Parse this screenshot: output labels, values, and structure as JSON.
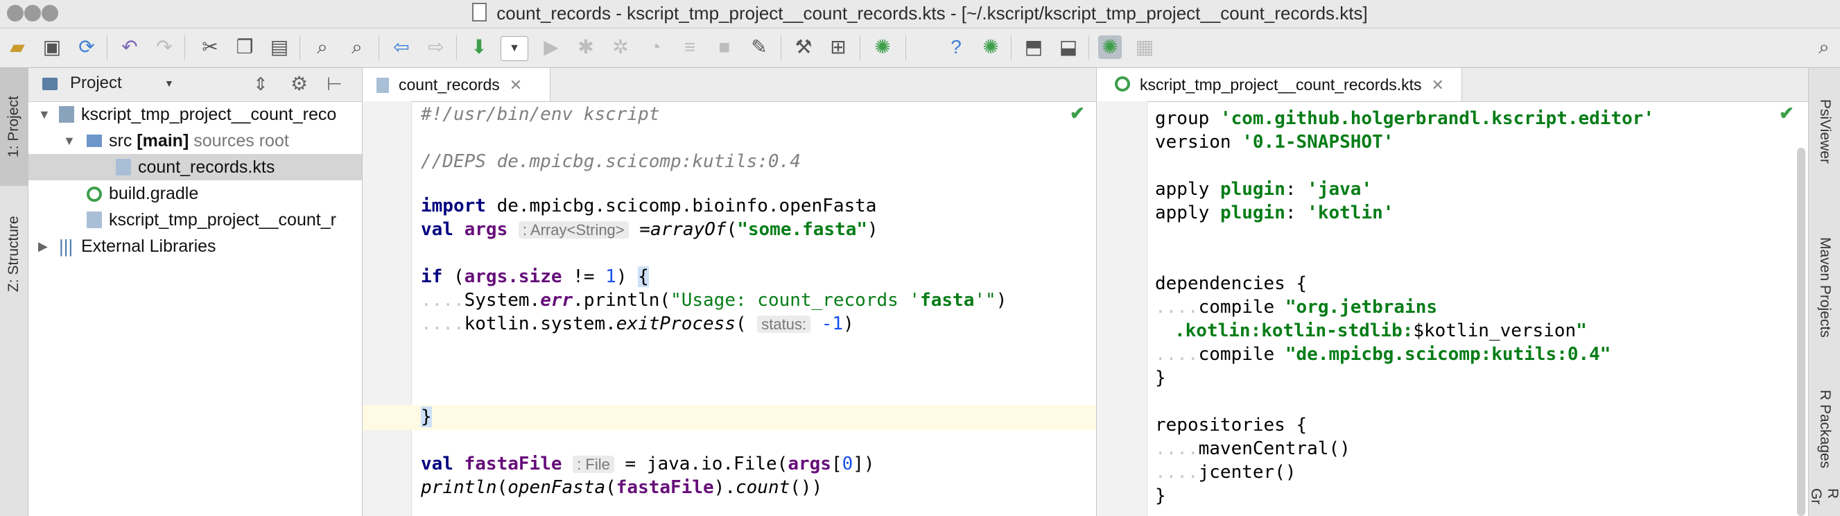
{
  "window": {
    "title": "count_records - kscript_tmp_project__count_records.kts - [~/.kscript/kscript_tmp_project__count_records.kts]"
  },
  "toolbar": {
    "icons": [
      "open-folder-icon",
      "save-icon",
      "sync-icon",
      "undo-icon",
      "redo-icon",
      "cut-icon",
      "copy-icon",
      "paste-icon",
      "find-icon",
      "replace-icon",
      "back-icon",
      "forward-icon",
      "build-icon",
      "run-config-dropdown",
      "run-icon",
      "debug-icon",
      "coverage-icon",
      "profile-icon",
      "attach-icon",
      "stop-icon",
      "edit-icon",
      "settings-icon",
      "project-structure-icon",
      "android-icon",
      "help-icon",
      "android-device-icon",
      "sdk-icon",
      "avd-icon",
      "android-monitor-icon",
      "layout-inspector-icon",
      "search-everywhere-icon"
    ]
  },
  "left_tools": {
    "project_tab": "1: Project",
    "structure_tab": "Z: Structure"
  },
  "project_panel": {
    "header": "Project",
    "tree": [
      {
        "label": "kscript_tmp_project__count_reco",
        "depth": 0,
        "expanded": true
      },
      {
        "label": "src",
        "bold": "[main]",
        "suffix": "sources root",
        "depth": 1,
        "expanded": true
      },
      {
        "label": "count_records.kts",
        "depth": 2,
        "selected": true
      },
      {
        "label": "build.gradle",
        "depth": 1
      },
      {
        "label": "kscript_tmp_project__count_r",
        "depth": 1
      },
      {
        "label": "External Libraries",
        "depth": 0,
        "expanded": false
      }
    ]
  },
  "editor1": {
    "tab": "count_records",
    "lines": {
      "l1": "#!/usr/bin/env kscript",
      "l3": "//DEPS de.mpicbg.scicomp:kutils:0.4",
      "l5_kw": "import",
      "l5_rest": " de.mpicbg.scicomp.bioinfo.openFasta",
      "l6_kw": "val",
      "l6_var": "args",
      "l6_hint": ": Array<String>",
      "l6_eq": " =",
      "l6_fn": "arrayOf",
      "l6_str": "\"some.fasta\"",
      "l8_kw": "if",
      "l8_a": "args",
      "l8_b": ".size",
      "l8_c": " != ",
      "l8_n": "1",
      "l9_a": "System.",
      "l9_b": "err",
      "l9_c": ".println(",
      "l9_s1": "\"Usage: count_records '",
      "l9_s2": "fasta",
      "l9_s3": "'\"",
      "l10_a": "kotlin.system.",
      "l10_b": "exitProcess",
      "l10_hint": "status:",
      "l10_n": "-1",
      "l11": "}",
      "l13_kw": "val",
      "l13_var": "fastaFile",
      "l13_hint": ": File",
      "l13_rest": " = java.io.File(",
      "l13_arg": "args",
      "l13_idx": "0",
      "l14_a": "println",
      "l14_b": "openFasta",
      "l14_c": "fastaFile",
      "l14_d": "count"
    }
  },
  "editor2": {
    "tab": "kscript_tmp_project__count_records.kts",
    "lines": {
      "group_kw": "group",
      "group_val": "'com.github.holgerbrandl.kscript.editor'",
      "version_kw": "version",
      "version_val": "'0.1-SNAPSHOT'",
      "apply1_kw": "apply",
      "apply1_p": "plugin",
      "apply1_v": "'java'",
      "apply2_kw": "apply",
      "apply2_p": "plugin",
      "apply2_v": "'kotlin'",
      "deps": "dependencies {",
      "compile1_kw": "compile",
      "compile1_v": "\"org.jetbrains",
      "compile1_v2": ".kotlin:kotlin-stdlib:",
      "compile1_v3": "$kotlin_version",
      "compile1_v4": "\"",
      "compile2_kw": "compile",
      "compile2_v": "\"de.mpicbg.scicomp:kutils:0.4\"",
      "close1": "}",
      "repos": "repositories {",
      "maven": "mavenCentral()",
      "jcenter": "jcenter()",
      "close2": "}"
    }
  },
  "right_tools": {
    "psi": "PsiViewer",
    "maven": "Maven Projects",
    "rpack": "R Packages",
    "rg": "R Gr"
  },
  "colors": {
    "keyword": "#000080",
    "string": "#067d17",
    "comment": "#808080",
    "field": "#660e7a",
    "number": "#1750eb"
  }
}
